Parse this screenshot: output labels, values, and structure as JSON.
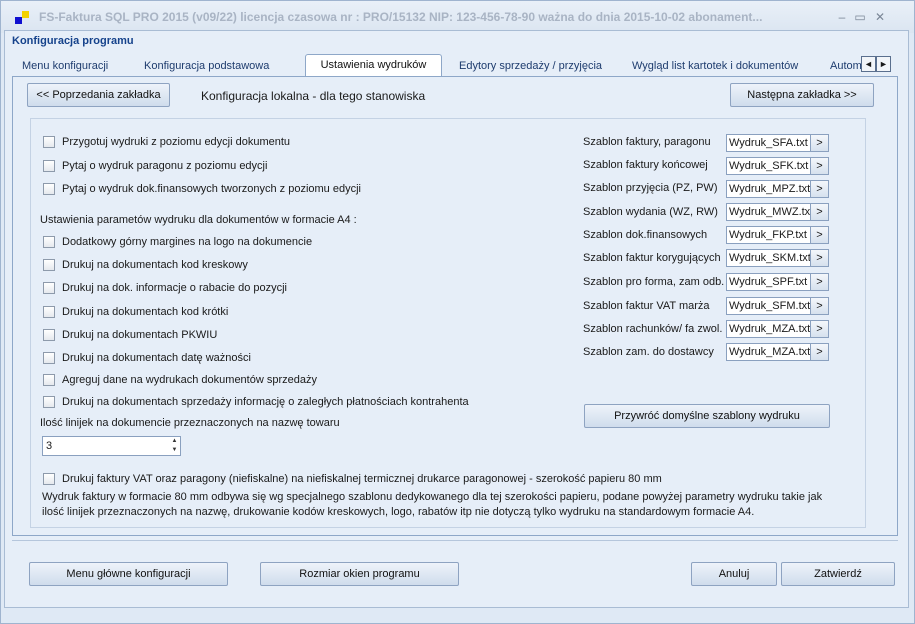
{
  "window": {
    "title": "FS-Faktura SQL PRO 2015 (v09/22)    licencja czasowa nr : PRO/15132    NIP: 123-456-78-90   ważna do dnia 2015-10-02    abonament...",
    "min_icon": "minimize-icon",
    "max_icon": "maximize-icon",
    "close_icon": "close-icon"
  },
  "frame_title": "Konfiguracja programu",
  "tabs": [
    {
      "label": "Menu konfiguracji"
    },
    {
      "label": "Konfiguracja podstawowa"
    },
    {
      "label": "Ustawienia wydruków"
    },
    {
      "label": "Edytory sprzedaży / przyjęcia"
    },
    {
      "label": "Wygląd list kartotek i dokumentów"
    },
    {
      "label": "Autom"
    }
  ],
  "tab_scroll": {
    "left": "◄",
    "right": "►"
  },
  "nav": {
    "prev": "<< Poprzedania zakładka",
    "next": "Następna zakładka >>",
    "header": "Konfiguracja lokalna - dla tego stanowiska"
  },
  "options_top": [
    "Przygotuj wydruki z poziomu edycji dokumentu",
    "Pytaj o wydruk paragonu z poziomu edycji",
    "Pytaj o wydruk dok.finansowych tworzonych z poziomu edycji"
  ],
  "a4_section_label": "Ustawienia parametów wydruku dla dokumentów w formacie A4 :",
  "options_a4": [
    "Dodatkowy górny margines na logo na dokumencie",
    "Drukuj na dokumentach kod kreskowy",
    "Drukuj na dok. informacje o rabacie do pozycji",
    "Drukuj na dokumentach kod krótki",
    "Drukuj na dokumentach PKWIU",
    "Drukuj na dokumentach datę ważności",
    "Agreguj dane na wydrukach dokumentów sprzedaży",
    "Drukuj na dokumentach sprzedaży informację o zaległych płatnościach kontrahenta"
  ],
  "lines_label": "Ilość linijek na dokumencie przeznaczonych na nazwę towaru",
  "lines_value": "3",
  "templates": [
    {
      "label": "Szablon faktury, paragonu",
      "value": "Wydruk_SFA.txt"
    },
    {
      "label": "Szablon faktury końcowej",
      "value": "Wydruk_SFK.txt"
    },
    {
      "label": "Szablon przyjęcia (PZ, PW)",
      "value": "Wydruk_MPZ.txt"
    },
    {
      "label": "Szablon wydania (WZ, RW)",
      "value": "Wydruk_MWZ.txt"
    },
    {
      "label": "Szablon dok.finansowych",
      "value": "Wydruk_FKP.txt"
    },
    {
      "label": "Szablon faktur korygujących",
      "value": "Wydruk_SKM.txt"
    },
    {
      "label": "Szablon pro forma, zam odb.",
      "value": "Wydruk_SPF.txt"
    },
    {
      "label": "Szablon faktur VAT marża",
      "value": "Wydruk_SFM.txt"
    },
    {
      "label": "Szablon rachunków/ fa zwol.",
      "value": "Wydruk_MZA.txt"
    },
    {
      "label": "Szablon zam. do dostawcy",
      "value": "Wydruk_MZA.txt"
    }
  ],
  "template_btn": ">",
  "restore_btn": "Przywróć domyślne szablony wydruku",
  "thermal_option": "Drukuj faktury VAT oraz paragony (niefiskalne) na niefiskalnej termicznej drukarce paragonowej - szerokość papieru 80 mm",
  "note": "Wydruk faktury w formacie 80 mm odbywa się wg specjalnego szablonu dedykowanego dla tej szerokości papieru, podane powyżej parametry wydruku takie jak ilość linijek przeznaczonych na nazwę, drukowanie kodów kreskowych, logo, rabatów itp nie dotyczą tylko wydruku na standardowym formacie A4.",
  "footer": {
    "menu": "Menu główne konfiguracji",
    "size": "Rozmiar okien programu",
    "cancel": "Anuluj",
    "confirm": "Zatwierdź"
  }
}
